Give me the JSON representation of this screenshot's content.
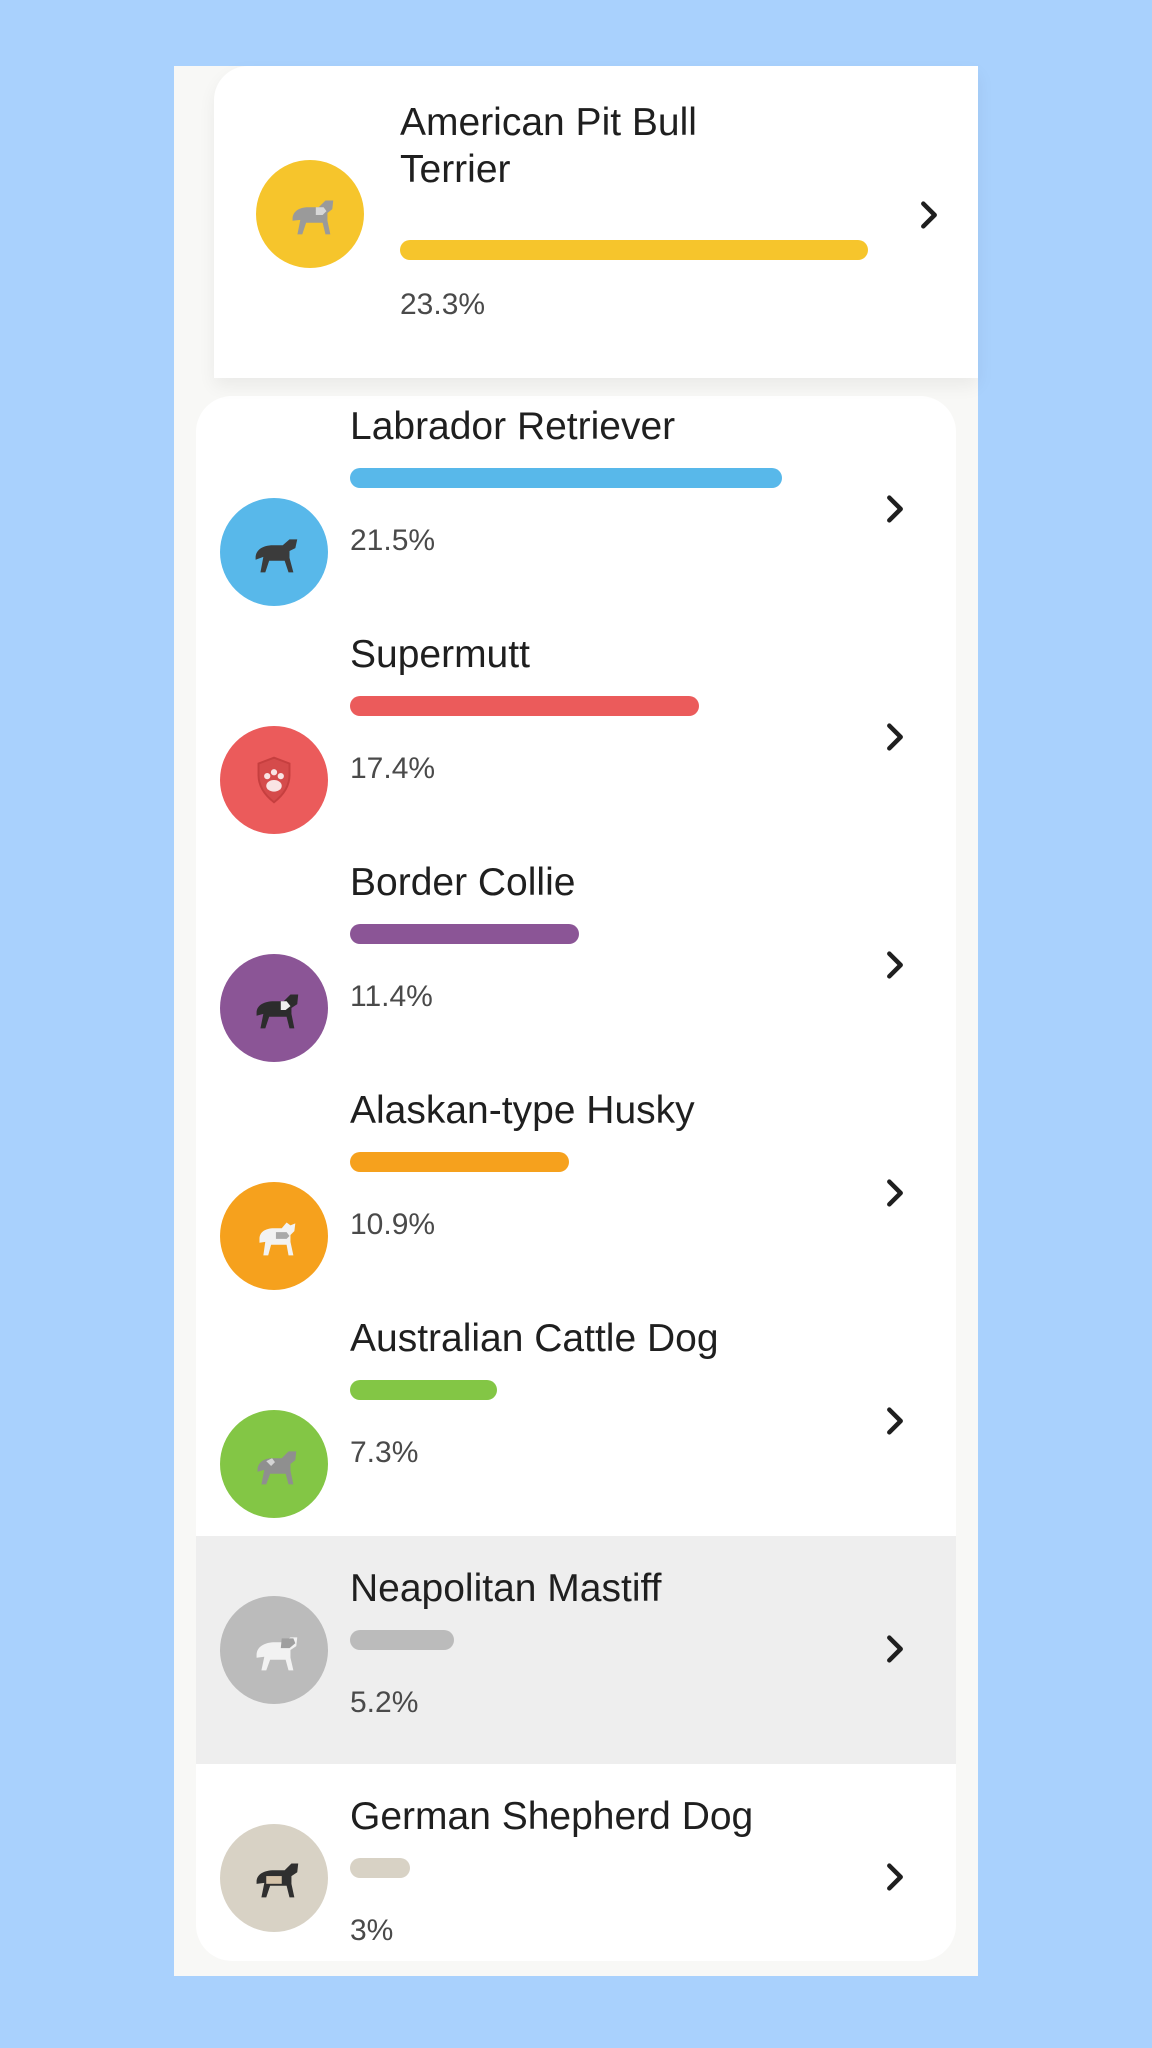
{
  "breeds": [
    {
      "name": "American Pit Bull Terrier",
      "percent_label": "23.3%",
      "percent": 23.3,
      "color": "#f6c52c",
      "icon": "dog-icon"
    },
    {
      "name": "Labrador Retriever",
      "percent_label": "21.5%",
      "percent": 21.5,
      "color": "#58b8ea",
      "icon": "dog-icon"
    },
    {
      "name": "Supermutt",
      "percent_label": "17.4%",
      "percent": 17.4,
      "color": "#eb5b5b",
      "icon": "paw-shield-icon"
    },
    {
      "name": "Border Collie",
      "percent_label": "11.4%",
      "percent": 11.4,
      "color": "#8b5596",
      "icon": "dog-icon"
    },
    {
      "name": "Alaskan-type Husky",
      "percent_label": "10.9%",
      "percent": 10.9,
      "color": "#f6a11d",
      "icon": "dog-icon"
    },
    {
      "name": "Australian Cattle Dog",
      "percent_label": "7.3%",
      "percent": 7.3,
      "color": "#83c645",
      "icon": "dog-icon"
    },
    {
      "name": "Neapolitan Mastiff",
      "percent_label": "5.2%",
      "percent": 5.2,
      "color": "#bbbbbb",
      "icon": "dog-icon"
    },
    {
      "name": "German Shepherd Dog",
      "percent_label": "3%",
      "percent": 3,
      "color": "#d8d2c5",
      "icon": "dog-icon"
    }
  ]
}
